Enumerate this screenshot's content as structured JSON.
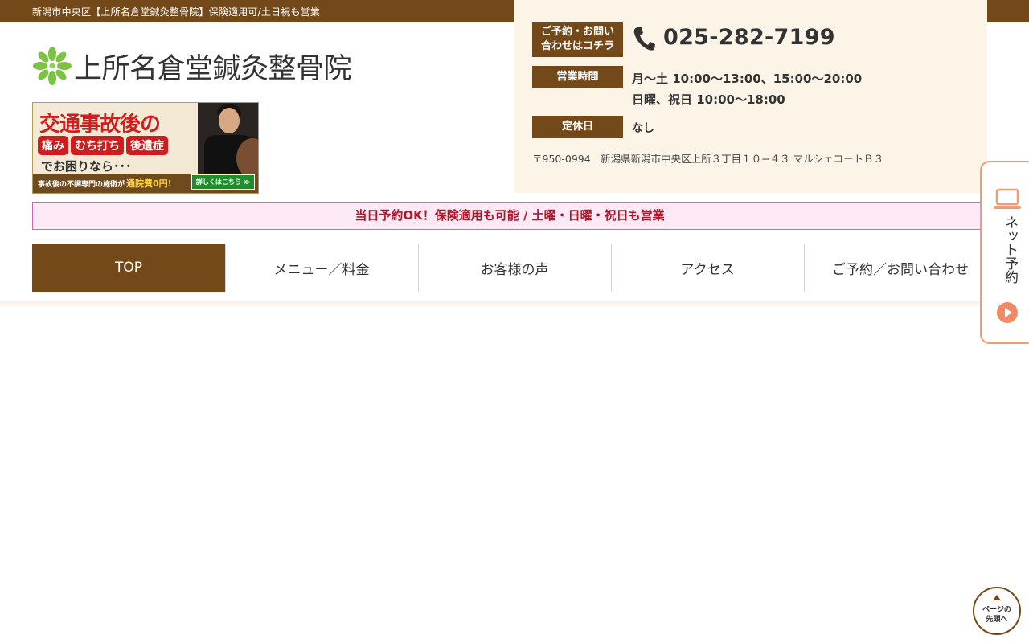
{
  "topbar": {
    "text": "新潟市中央区【上所名倉堂鍼灸整骨院】保険適用可/土日祝も営業"
  },
  "logo": {
    "text": "上所名倉堂鍼灸整骨院"
  },
  "banner": {
    "title": "交通事故後の",
    "tags": [
      "痛み",
      "むち打ち",
      "後遺症"
    ],
    "subtitle": "でお困りなら･･･",
    "footer_text": "事故後の不調専門の施術が",
    "free_text": "通院費0円!",
    "button": "詳しくはこちら ≫"
  },
  "info": {
    "contact_label_1": "ご予約・お問い",
    "contact_label_2": "合わせはコチラ",
    "phone": "025-282-7199",
    "hours_label": "営業時間",
    "hours_line_1": "月〜土 10:00〜13:00、15:00〜20:00",
    "hours_line_2": "日曜、祝日 10:00〜18:00",
    "closed_label": "定休日",
    "closed_value": "なし",
    "address": "〒950-0994　新潟県新潟市中央区上所３丁目１０−４３ マルシェコートＢ３"
  },
  "announcement": "当日予約OK！保険適用も可能 / 土曜・日曜・祝日も営業",
  "nav": {
    "items": [
      "TOP",
      "メニュー／料金",
      "お客様の声",
      "アクセス",
      "ご予約／お問い合わせ"
    ]
  },
  "side_tab": {
    "label": "ネット予約"
  },
  "pagetop": {
    "line_1": "ページの",
    "line_2": "先頭へ"
  },
  "colors": {
    "brand_brown": "#74491a",
    "info_bg": "#fdf4e8",
    "announce_bg": "#fde8f5",
    "announce_text": "#b0172a",
    "side_accent": "#f19a73"
  }
}
